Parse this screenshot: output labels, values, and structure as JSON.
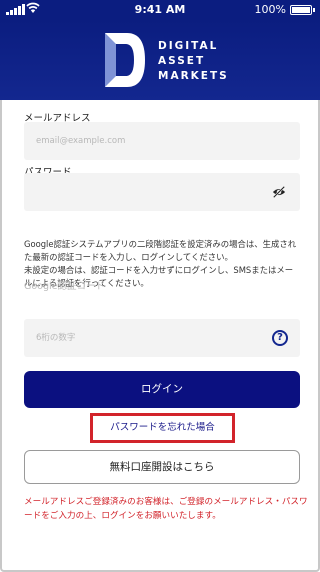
{
  "status_bar": {
    "time": "9:41 AM",
    "battery_percent": "100%"
  },
  "header": {
    "logo_line1": "Digital",
    "logo_line2": "Asset",
    "logo_line3": "Markets",
    "background_color": "#0b1d80"
  },
  "form": {
    "email_label": "メールアドレス",
    "email_placeholder": "email@example.com",
    "password_label": "パスワード",
    "password_value": "",
    "password_toggle_icon": "eye-slash-icon",
    "notice_line1": "Google認証システムアプリの二段階認証を設定済みの場合は、生成された最新の認証コードを入力し、ログインしてください。",
    "notice_line2": "未設定の場合は、認証コードを入力せずにログインし、SMSまたはメールによる認証を行ってください。",
    "google_code_label": "Google認証コード",
    "google_code_placeholder": "6桁の数字",
    "help_icon": "question-circle-icon",
    "help_glyph": "?"
  },
  "actions": {
    "login_label": "ログイン",
    "forgot_password_label": "パスワードを忘れた場合",
    "signup_label": "無料口座開設はこちら",
    "primary_color": "#0b1080",
    "highlight_color": "#d2232a"
  },
  "footer_note": "メールアドレスご登録済みのお客様は、ご登録のメールアドレス・パスワードをご入力の上、ログインをお願いいたします。"
}
